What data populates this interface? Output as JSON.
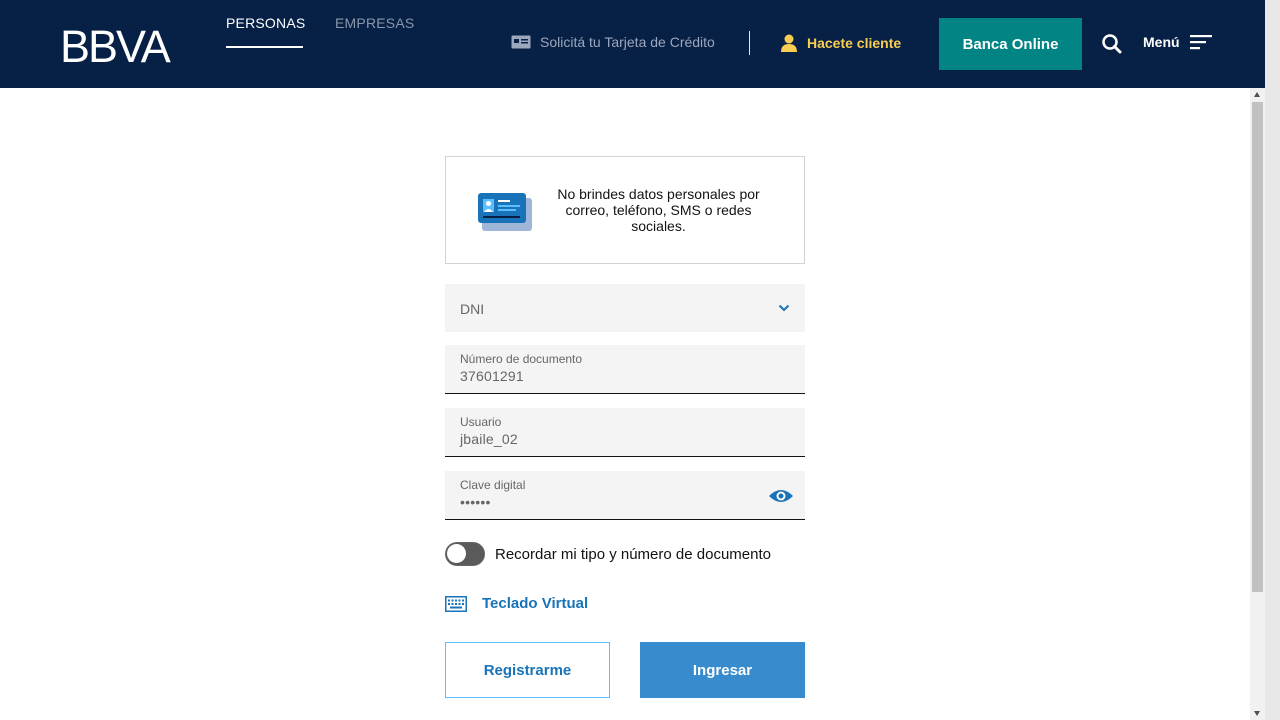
{
  "header": {
    "logo_text": "BBVA",
    "tabs": [
      {
        "label": "PERSONAS",
        "active": true
      },
      {
        "label": "EMPRESAS",
        "active": false
      }
    ],
    "credit_card_link": "Solicitá tu Tarjeta de Crédito",
    "client_link": "Hacete cliente",
    "banca_online": "Banca Online",
    "menu_label": "Menú"
  },
  "notice": {
    "text": "No brindes datos personales por correo, teléfono, SMS o redes sociales."
  },
  "form": {
    "doc_type": "DNI",
    "doc_number_label": "Número de documento",
    "doc_number_value": "37601291",
    "user_label": "Usuario",
    "user_value": "jbaile_02",
    "password_label": "Clave digital",
    "password_value": "••••••",
    "remember_label": "Recordar mi tipo y número de documento",
    "remember_on": false,
    "virtual_keyboard": "Teclado Virtual",
    "register_button": "Registrarme",
    "login_button": "Ingresar"
  },
  "colors": {
    "header_bg": "#072146",
    "teal": "#028484",
    "yellow": "#f8cd51",
    "blue": "#1973b8",
    "button_blue": "#388bcd"
  },
  "icons": {
    "credit_card": "card-icon",
    "client": "person-icon",
    "search": "search-icon",
    "menu": "hamburger-icon",
    "notice": "id-card-icon",
    "chevron": "chevron-down-icon",
    "eye": "eye-icon",
    "keyboard": "keyboard-icon"
  }
}
